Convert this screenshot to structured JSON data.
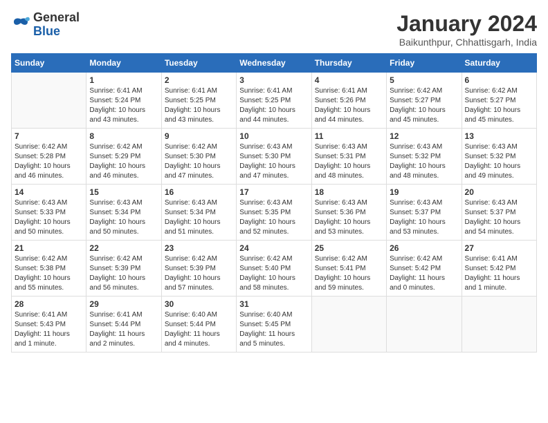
{
  "logo": {
    "general": "General",
    "blue": "Blue"
  },
  "title": "January 2024",
  "location": "Baikunthpur, Chhattisgarh, India",
  "days": [
    "Sunday",
    "Monday",
    "Tuesday",
    "Wednesday",
    "Thursday",
    "Friday",
    "Saturday"
  ],
  "weeks": [
    [
      {
        "day": "",
        "info": ""
      },
      {
        "day": "1",
        "info": "Sunrise: 6:41 AM\nSunset: 5:24 PM\nDaylight: 10 hours\nand 43 minutes."
      },
      {
        "day": "2",
        "info": "Sunrise: 6:41 AM\nSunset: 5:25 PM\nDaylight: 10 hours\nand 43 minutes."
      },
      {
        "day": "3",
        "info": "Sunrise: 6:41 AM\nSunset: 5:25 PM\nDaylight: 10 hours\nand 44 minutes."
      },
      {
        "day": "4",
        "info": "Sunrise: 6:41 AM\nSunset: 5:26 PM\nDaylight: 10 hours\nand 44 minutes."
      },
      {
        "day": "5",
        "info": "Sunrise: 6:42 AM\nSunset: 5:27 PM\nDaylight: 10 hours\nand 45 minutes."
      },
      {
        "day": "6",
        "info": "Sunrise: 6:42 AM\nSunset: 5:27 PM\nDaylight: 10 hours\nand 45 minutes."
      }
    ],
    [
      {
        "day": "7",
        "info": "Sunrise: 6:42 AM\nSunset: 5:28 PM\nDaylight: 10 hours\nand 46 minutes."
      },
      {
        "day": "8",
        "info": "Sunrise: 6:42 AM\nSunset: 5:29 PM\nDaylight: 10 hours\nand 46 minutes."
      },
      {
        "day": "9",
        "info": "Sunrise: 6:42 AM\nSunset: 5:30 PM\nDaylight: 10 hours\nand 47 minutes."
      },
      {
        "day": "10",
        "info": "Sunrise: 6:43 AM\nSunset: 5:30 PM\nDaylight: 10 hours\nand 47 minutes."
      },
      {
        "day": "11",
        "info": "Sunrise: 6:43 AM\nSunset: 5:31 PM\nDaylight: 10 hours\nand 48 minutes."
      },
      {
        "day": "12",
        "info": "Sunrise: 6:43 AM\nSunset: 5:32 PM\nDaylight: 10 hours\nand 48 minutes."
      },
      {
        "day": "13",
        "info": "Sunrise: 6:43 AM\nSunset: 5:32 PM\nDaylight: 10 hours\nand 49 minutes."
      }
    ],
    [
      {
        "day": "14",
        "info": "Sunrise: 6:43 AM\nSunset: 5:33 PM\nDaylight: 10 hours\nand 50 minutes."
      },
      {
        "day": "15",
        "info": "Sunrise: 6:43 AM\nSunset: 5:34 PM\nDaylight: 10 hours\nand 50 minutes."
      },
      {
        "day": "16",
        "info": "Sunrise: 6:43 AM\nSunset: 5:34 PM\nDaylight: 10 hours\nand 51 minutes."
      },
      {
        "day": "17",
        "info": "Sunrise: 6:43 AM\nSunset: 5:35 PM\nDaylight: 10 hours\nand 52 minutes."
      },
      {
        "day": "18",
        "info": "Sunrise: 6:43 AM\nSunset: 5:36 PM\nDaylight: 10 hours\nand 53 minutes."
      },
      {
        "day": "19",
        "info": "Sunrise: 6:43 AM\nSunset: 5:37 PM\nDaylight: 10 hours\nand 53 minutes."
      },
      {
        "day": "20",
        "info": "Sunrise: 6:43 AM\nSunset: 5:37 PM\nDaylight: 10 hours\nand 54 minutes."
      }
    ],
    [
      {
        "day": "21",
        "info": "Sunrise: 6:42 AM\nSunset: 5:38 PM\nDaylight: 10 hours\nand 55 minutes."
      },
      {
        "day": "22",
        "info": "Sunrise: 6:42 AM\nSunset: 5:39 PM\nDaylight: 10 hours\nand 56 minutes."
      },
      {
        "day": "23",
        "info": "Sunrise: 6:42 AM\nSunset: 5:39 PM\nDaylight: 10 hours\nand 57 minutes."
      },
      {
        "day": "24",
        "info": "Sunrise: 6:42 AM\nSunset: 5:40 PM\nDaylight: 10 hours\nand 58 minutes."
      },
      {
        "day": "25",
        "info": "Sunrise: 6:42 AM\nSunset: 5:41 PM\nDaylight: 10 hours\nand 59 minutes."
      },
      {
        "day": "26",
        "info": "Sunrise: 6:42 AM\nSunset: 5:42 PM\nDaylight: 11 hours\nand 0 minutes."
      },
      {
        "day": "27",
        "info": "Sunrise: 6:41 AM\nSunset: 5:42 PM\nDaylight: 11 hours\nand 1 minute."
      }
    ],
    [
      {
        "day": "28",
        "info": "Sunrise: 6:41 AM\nSunset: 5:43 PM\nDaylight: 11 hours\nand 1 minute."
      },
      {
        "day": "29",
        "info": "Sunrise: 6:41 AM\nSunset: 5:44 PM\nDaylight: 11 hours\nand 2 minutes."
      },
      {
        "day": "30",
        "info": "Sunrise: 6:40 AM\nSunset: 5:44 PM\nDaylight: 11 hours\nand 4 minutes."
      },
      {
        "day": "31",
        "info": "Sunrise: 6:40 AM\nSunset: 5:45 PM\nDaylight: 11 hours\nand 5 minutes."
      },
      {
        "day": "",
        "info": ""
      },
      {
        "day": "",
        "info": ""
      },
      {
        "day": "",
        "info": ""
      }
    ]
  ]
}
